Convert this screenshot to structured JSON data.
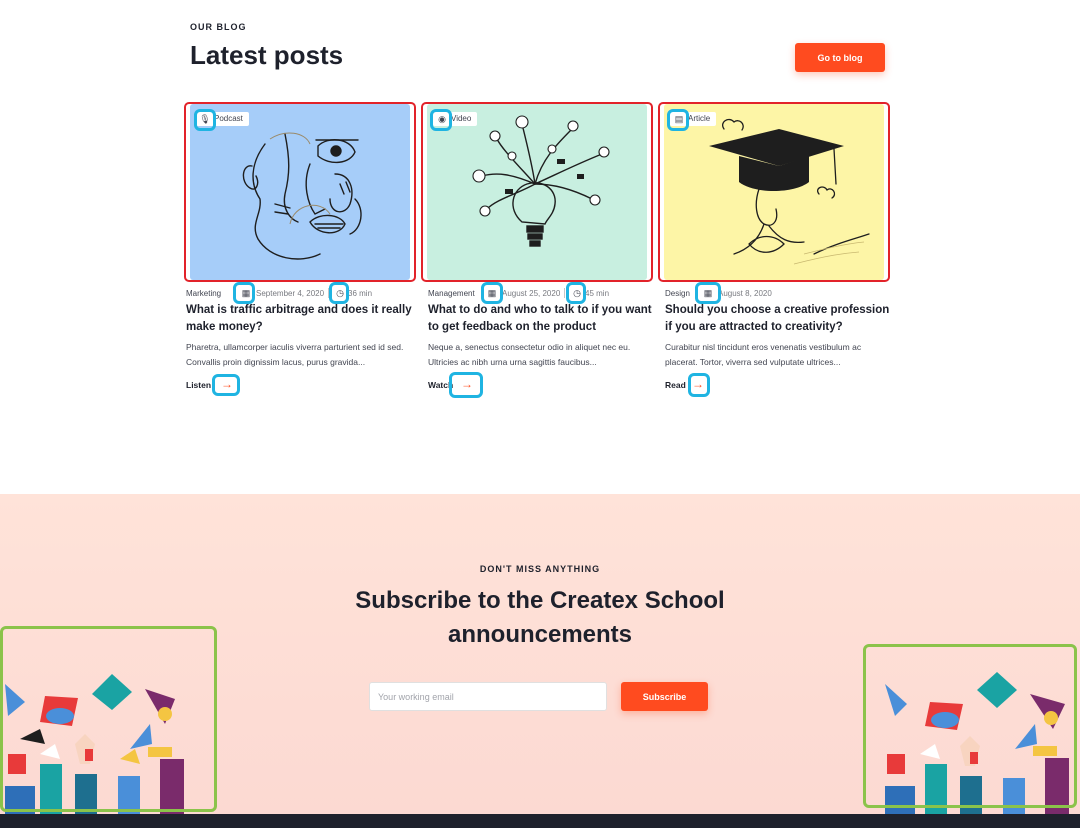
{
  "blog": {
    "eyebrow": "OUR BLOG",
    "title": "Latest posts",
    "go_label": "Go to blog",
    "posts": [
      {
        "badge": "Podcast",
        "category": "Marketing",
        "date": "September 4, 2020",
        "duration": "36 min",
        "title": "What is traffic arbitrage and does it really make money?",
        "excerpt": "Pharetra, ullamcorper iaculis viverra parturient sed id sed. Convallis proin dignissim lacus, purus gravida...",
        "cta": "Listen",
        "image_bg": "#a6cdf9"
      },
      {
        "badge": "Video",
        "category": "Management",
        "date": "August 25, 2020",
        "duration": "45 min",
        "title": "What to do and who to talk to if you want to get feedback on the product",
        "excerpt": "Neque a, senectus consectetur odio in aliquet nec eu. Ultricies ac nibh urna urna sagittis faucibus...",
        "cta": "Watch",
        "image_bg": "#c8efe0"
      },
      {
        "badge": "Article",
        "category": "Design",
        "date": "August 8, 2020",
        "title": "Should you choose a creative profession if you are attracted to creativity?",
        "excerpt": "Curabitur nisl tincidunt eros venenatis vestibulum ac placerat. Tortor, viverra sed vulputate ultrices...",
        "cta": "Read",
        "image_bg": "#fdf5a6"
      }
    ]
  },
  "subscribe": {
    "eyebrow": "DON'T MISS ANYTHING",
    "title_line1": "Subscribe to the Createx School",
    "title_line2": "announcements",
    "email_placeholder": "Your working email",
    "button_label": "Subscribe"
  },
  "colors": {
    "accent": "#ff4b1f",
    "highlight_blue": "#1fb4e2",
    "highlight_red": "#e2232a",
    "highlight_green": "#8bc34a"
  },
  "icons": {
    "podcast": "microphone-icon",
    "video": "play-icon",
    "article": "file-icon",
    "calendar": "calendar-icon",
    "clock": "clock-icon",
    "arrow": "arrow-right-icon"
  }
}
